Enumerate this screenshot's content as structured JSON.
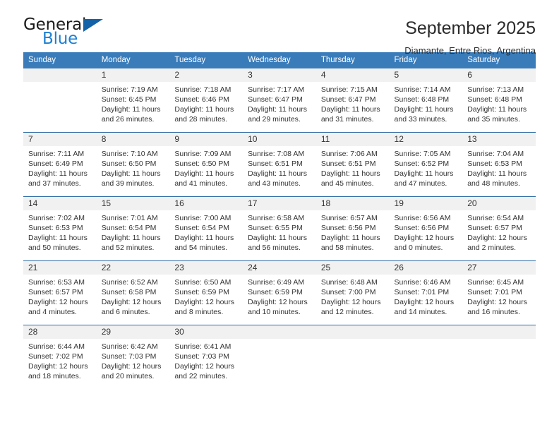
{
  "logo": {
    "word_top": "General",
    "word_bottom": "Blue",
    "triangle_color": "#1362a8",
    "blue_color": "#1c7fd1"
  },
  "header": {
    "title": "September 2025",
    "subtitle": "Diamante, Entre Rios, Argentina"
  },
  "theme": {
    "header_bg": "#3a7cba",
    "row_divider": "#2e6da4",
    "daynum_bg": "#f1f1f1",
    "text": "#333333"
  },
  "weekday_headers": [
    "Sunday",
    "Monday",
    "Tuesday",
    "Wednesday",
    "Thursday",
    "Friday",
    "Saturday"
  ],
  "weeks": [
    [
      {
        "day": "",
        "sunrise": "",
        "sunset": "",
        "daylight_line1": "",
        "daylight_line2": ""
      },
      {
        "day": "1",
        "sunrise": "Sunrise: 7:19 AM",
        "sunset": "Sunset: 6:45 PM",
        "daylight_line1": "Daylight: 11 hours",
        "daylight_line2": "and 26 minutes."
      },
      {
        "day": "2",
        "sunrise": "Sunrise: 7:18 AM",
        "sunset": "Sunset: 6:46 PM",
        "daylight_line1": "Daylight: 11 hours",
        "daylight_line2": "and 28 minutes."
      },
      {
        "day": "3",
        "sunrise": "Sunrise: 7:17 AM",
        "sunset": "Sunset: 6:47 PM",
        "daylight_line1": "Daylight: 11 hours",
        "daylight_line2": "and 29 minutes."
      },
      {
        "day": "4",
        "sunrise": "Sunrise: 7:15 AM",
        "sunset": "Sunset: 6:47 PM",
        "daylight_line1": "Daylight: 11 hours",
        "daylight_line2": "and 31 minutes."
      },
      {
        "day": "5",
        "sunrise": "Sunrise: 7:14 AM",
        "sunset": "Sunset: 6:48 PM",
        "daylight_line1": "Daylight: 11 hours",
        "daylight_line2": "and 33 minutes."
      },
      {
        "day": "6",
        "sunrise": "Sunrise: 7:13 AM",
        "sunset": "Sunset: 6:48 PM",
        "daylight_line1": "Daylight: 11 hours",
        "daylight_line2": "and 35 minutes."
      }
    ],
    [
      {
        "day": "7",
        "sunrise": "Sunrise: 7:11 AM",
        "sunset": "Sunset: 6:49 PM",
        "daylight_line1": "Daylight: 11 hours",
        "daylight_line2": "and 37 minutes."
      },
      {
        "day": "8",
        "sunrise": "Sunrise: 7:10 AM",
        "sunset": "Sunset: 6:50 PM",
        "daylight_line1": "Daylight: 11 hours",
        "daylight_line2": "and 39 minutes."
      },
      {
        "day": "9",
        "sunrise": "Sunrise: 7:09 AM",
        "sunset": "Sunset: 6:50 PM",
        "daylight_line1": "Daylight: 11 hours",
        "daylight_line2": "and 41 minutes."
      },
      {
        "day": "10",
        "sunrise": "Sunrise: 7:08 AM",
        "sunset": "Sunset: 6:51 PM",
        "daylight_line1": "Daylight: 11 hours",
        "daylight_line2": "and 43 minutes."
      },
      {
        "day": "11",
        "sunrise": "Sunrise: 7:06 AM",
        "sunset": "Sunset: 6:51 PM",
        "daylight_line1": "Daylight: 11 hours",
        "daylight_line2": "and 45 minutes."
      },
      {
        "day": "12",
        "sunrise": "Sunrise: 7:05 AM",
        "sunset": "Sunset: 6:52 PM",
        "daylight_line1": "Daylight: 11 hours",
        "daylight_line2": "and 47 minutes."
      },
      {
        "day": "13",
        "sunrise": "Sunrise: 7:04 AM",
        "sunset": "Sunset: 6:53 PM",
        "daylight_line1": "Daylight: 11 hours",
        "daylight_line2": "and 48 minutes."
      }
    ],
    [
      {
        "day": "14",
        "sunrise": "Sunrise: 7:02 AM",
        "sunset": "Sunset: 6:53 PM",
        "daylight_line1": "Daylight: 11 hours",
        "daylight_line2": "and 50 minutes."
      },
      {
        "day": "15",
        "sunrise": "Sunrise: 7:01 AM",
        "sunset": "Sunset: 6:54 PM",
        "daylight_line1": "Daylight: 11 hours",
        "daylight_line2": "and 52 minutes."
      },
      {
        "day": "16",
        "sunrise": "Sunrise: 7:00 AM",
        "sunset": "Sunset: 6:54 PM",
        "daylight_line1": "Daylight: 11 hours",
        "daylight_line2": "and 54 minutes."
      },
      {
        "day": "17",
        "sunrise": "Sunrise: 6:58 AM",
        "sunset": "Sunset: 6:55 PM",
        "daylight_line1": "Daylight: 11 hours",
        "daylight_line2": "and 56 minutes."
      },
      {
        "day": "18",
        "sunrise": "Sunrise: 6:57 AM",
        "sunset": "Sunset: 6:56 PM",
        "daylight_line1": "Daylight: 11 hours",
        "daylight_line2": "and 58 minutes."
      },
      {
        "day": "19",
        "sunrise": "Sunrise: 6:56 AM",
        "sunset": "Sunset: 6:56 PM",
        "daylight_line1": "Daylight: 12 hours",
        "daylight_line2": "and 0 minutes."
      },
      {
        "day": "20",
        "sunrise": "Sunrise: 6:54 AM",
        "sunset": "Sunset: 6:57 PM",
        "daylight_line1": "Daylight: 12 hours",
        "daylight_line2": "and 2 minutes."
      }
    ],
    [
      {
        "day": "21",
        "sunrise": "Sunrise: 6:53 AM",
        "sunset": "Sunset: 6:57 PM",
        "daylight_line1": "Daylight: 12 hours",
        "daylight_line2": "and 4 minutes."
      },
      {
        "day": "22",
        "sunrise": "Sunrise: 6:52 AM",
        "sunset": "Sunset: 6:58 PM",
        "daylight_line1": "Daylight: 12 hours",
        "daylight_line2": "and 6 minutes."
      },
      {
        "day": "23",
        "sunrise": "Sunrise: 6:50 AM",
        "sunset": "Sunset: 6:59 PM",
        "daylight_line1": "Daylight: 12 hours",
        "daylight_line2": "and 8 minutes."
      },
      {
        "day": "24",
        "sunrise": "Sunrise: 6:49 AM",
        "sunset": "Sunset: 6:59 PM",
        "daylight_line1": "Daylight: 12 hours",
        "daylight_line2": "and 10 minutes."
      },
      {
        "day": "25",
        "sunrise": "Sunrise: 6:48 AM",
        "sunset": "Sunset: 7:00 PM",
        "daylight_line1": "Daylight: 12 hours",
        "daylight_line2": "and 12 minutes."
      },
      {
        "day": "26",
        "sunrise": "Sunrise: 6:46 AM",
        "sunset": "Sunset: 7:01 PM",
        "daylight_line1": "Daylight: 12 hours",
        "daylight_line2": "and 14 minutes."
      },
      {
        "day": "27",
        "sunrise": "Sunrise: 6:45 AM",
        "sunset": "Sunset: 7:01 PM",
        "daylight_line1": "Daylight: 12 hours",
        "daylight_line2": "and 16 minutes."
      }
    ],
    [
      {
        "day": "28",
        "sunrise": "Sunrise: 6:44 AM",
        "sunset": "Sunset: 7:02 PM",
        "daylight_line1": "Daylight: 12 hours",
        "daylight_line2": "and 18 minutes."
      },
      {
        "day": "29",
        "sunrise": "Sunrise: 6:42 AM",
        "sunset": "Sunset: 7:03 PM",
        "daylight_line1": "Daylight: 12 hours",
        "daylight_line2": "and 20 minutes."
      },
      {
        "day": "30",
        "sunrise": "Sunrise: 6:41 AM",
        "sunset": "Sunset: 7:03 PM",
        "daylight_line1": "Daylight: 12 hours",
        "daylight_line2": "and 22 minutes."
      },
      {
        "day": "",
        "sunrise": "",
        "sunset": "",
        "daylight_line1": "",
        "daylight_line2": ""
      },
      {
        "day": "",
        "sunrise": "",
        "sunset": "",
        "daylight_line1": "",
        "daylight_line2": ""
      },
      {
        "day": "",
        "sunrise": "",
        "sunset": "",
        "daylight_line1": "",
        "daylight_line2": ""
      },
      {
        "day": "",
        "sunrise": "",
        "sunset": "",
        "daylight_line1": "",
        "daylight_line2": ""
      }
    ]
  ]
}
